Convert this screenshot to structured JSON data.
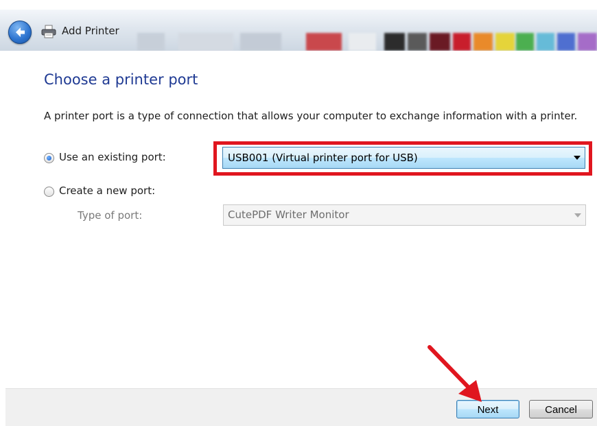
{
  "window": {
    "title": "Add Printer"
  },
  "page": {
    "heading": "Choose a printer port",
    "description": "A printer port is a type of connection that allows your computer to exchange information with a printer."
  },
  "options": {
    "existing": {
      "label": "Use an existing port:",
      "selected": true,
      "value": "USB001 (Virtual printer port for USB)"
    },
    "new": {
      "label": "Create a new port:",
      "selected": false,
      "type_label": "Type of port:",
      "type_value": "CutePDF Writer Monitor"
    }
  },
  "buttons": {
    "next": "Next",
    "cancel": "Cancel"
  },
  "colors": {
    "accent": "#1f3a93",
    "highlight": "#e0161f"
  },
  "icons": [
    "back-arrow-icon",
    "printer-icon",
    "dropdown-caret-icon",
    "annotation-arrow-icon"
  ]
}
